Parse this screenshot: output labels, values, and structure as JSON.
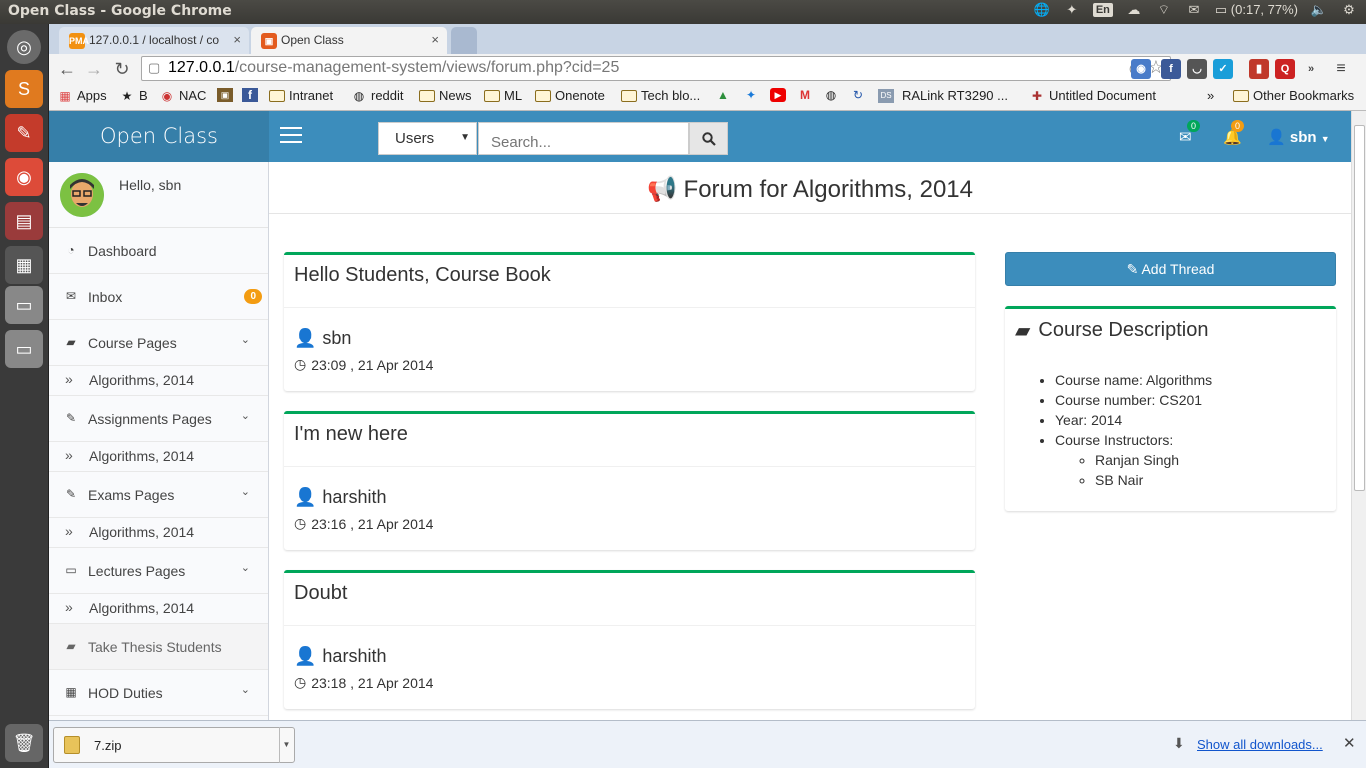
{
  "os": {
    "window_title": "Open Class - Google Chrome",
    "keyboard": "En",
    "battery": "(0:17, 77%)"
  },
  "browser": {
    "tabs": [
      {
        "label": "127.0.0.1 / localhost / co"
      },
      {
        "label": "Open Class"
      }
    ],
    "url_host": "127.0.0.1",
    "url_path": "/course-management-system/views/forum.php?cid=25",
    "bookmarks": [
      {
        "label": "Apps"
      },
      {
        "label": "B"
      },
      {
        "label": "NAC"
      },
      {
        "label": "Intranet"
      },
      {
        "label": "reddit"
      },
      {
        "label": "News"
      },
      {
        "label": "ML"
      },
      {
        "label": "Onenote"
      },
      {
        "label": "Tech blo..."
      },
      {
        "label": "RALink RT3290 ..."
      },
      {
        "label": "Untitled Document"
      },
      {
        "label": "»"
      },
      {
        "label": "Other Bookmarks"
      }
    ]
  },
  "app": {
    "logo": "Open Class",
    "search_select": "Users",
    "search_placeholder": "Search...",
    "mail_count": "0",
    "notif_count": "0",
    "username": "sbn"
  },
  "sidebar": {
    "greeting": "Hello, sbn",
    "items": [
      {
        "label": "Dashboard"
      },
      {
        "label": "Inbox",
        "badge": "0"
      },
      {
        "label": "Course Pages",
        "sub": "Algorithms, 2014"
      },
      {
        "label": "Assignments Pages",
        "sub": "Algorithms, 2014"
      },
      {
        "label": "Exams Pages",
        "sub": "Algorithms, 2014"
      },
      {
        "label": "Lectures Pages",
        "sub": "Algorithms, 2014"
      },
      {
        "label": "Take Thesis Students"
      },
      {
        "label": "HOD Duties"
      }
    ]
  },
  "main": {
    "title": "Forum for Algorithms, 2014",
    "threads": [
      {
        "title": "Hello Students, Course Book",
        "author": "sbn",
        "time": "23:09 , 21 Apr 2014"
      },
      {
        "title": "I'm new here",
        "author": "harshith",
        "time": "23:16 , 21 Apr 2014"
      },
      {
        "title": "Doubt",
        "author": "harshith",
        "time": "23:18 , 21 Apr 2014"
      }
    ],
    "add_thread": "Add Thread",
    "course_description": {
      "title": "Course Description",
      "items": [
        "Course name: Algorithms",
        "Course number: CS201",
        "Year: 2014",
        "Course Instructors:"
      ],
      "instructors": [
        "Ranjan Singh",
        "SB Nair"
      ]
    }
  },
  "downloads": {
    "file": "7.zip",
    "show_all": "Show all downloads..."
  },
  "colors": {
    "primary": "#3c8dbc",
    "primary_dark": "#367fa9",
    "box_border": "#00a65a",
    "badge_orange": "#f39c12",
    "badge_green": "#00a65a"
  }
}
